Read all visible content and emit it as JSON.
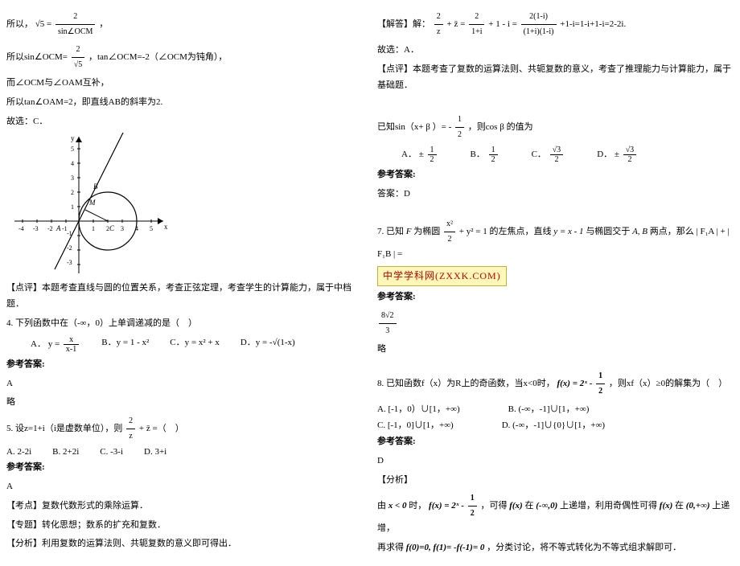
{
  "col1": {
    "line1_pre": "所以，",
    "line1_sqrt": "√5",
    "line1_eq": "=",
    "line1_frac_n": "2",
    "line1_frac_d": "sin∠OCM",
    "line1_post": "，",
    "line2_pre": "所以sin∠OCM=",
    "line2_frac_n": "2",
    "line2_frac_d": "√5",
    "line2_post": "，tan∠OCM=-2（∠OCM为钝角），",
    "line3": "而∠OCM与∠OAM互补，",
    "line4": "所以tan∠OAM=2，即直线AB的斜率为2.",
    "line5": "故选：C．",
    "comment1": "【点评】本题考查直线与圆的位置关系，考查正弦定理，考查学生的计算能力，属于中档题．",
    "q4_stem": "4. 下列函数中在（-∞，0）上单调递减的是（　）",
    "q4_opts": {
      "a_pre": "A．",
      "a_body": "y =",
      "b_pre": "B．",
      "b_body": "y = 1 - x²",
      "c_pre": "C．",
      "c_body": "y = x² + x",
      "d_pre": "D．",
      "d_body": "y = -√(1-x)"
    },
    "q4_fracA_n": "x",
    "q4_fracA_d": "x-1",
    "ref_label": "参考答案:",
    "q4_ans": "A",
    "q4_ext": "略",
    "q5_stem_pre": "5. 设z=1+i（i是虚数单位），则",
    "q5_frac_n": "2",
    "q5_frac_d": "z",
    "q5_plus": "+ z̄",
    "q5_stem_post": "=（　）",
    "q5_opts": {
      "a": "A. 2-2i",
      "b": "B. 2+2i",
      "c": "C. -3-i",
      "d": "D. 3+i"
    },
    "q5_ans": "A",
    "kd": "【考点】复数代数形式的乘除运算．",
    "zt": "【专题】转化思想；数系的扩充和复数．",
    "fx": "【分析】利用复数的运算法则、共轭复数的意义即可得出．"
  },
  "col2": {
    "jda_pre": "【解答】解：",
    "jda_frac1_n": "2",
    "jda_frac1_d": "z",
    "jda_plus": "+ z̄",
    "jda_eq1": " = ",
    "jda_frac2_n": "2",
    "jda_frac2_d": "1+i",
    "jda_plus2": " + 1 - i ",
    "jda_eq2": "= ",
    "jda_frac3_n": "2(1-i)",
    "jda_frac3_d": "(1+i)(1-i)",
    "jda_tail": " +1-i=1-i+1-i=2-2i.",
    "gx": "故选：A．",
    "dp": "【点评】本题考查了复数的运算法则、共轭复数的意义，考查了推理能力与计算能力，属于基础题．",
    "q6_stem_pre": "已知sin（x+",
    "q6_beta": "β",
    "q6_stem_mid": "）= ",
    "q6_frac_n": "1",
    "q6_frac_d": "2",
    "q6_neg": "-",
    "q6_stem_post": "，则cos",
    "q6_beta2": "β",
    "q6_stem_end": "的值为",
    "q6_opts_pm": "±",
    "q6_opts_half_n": "1",
    "q6_opts_half_d": "2",
    "q6_opts_r3_n": "√3",
    "q6_opts_r3_d": "2",
    "q6_labels": {
      "a": "A．",
      "b": "B．",
      "c": "C．",
      "d": "D．"
    },
    "ref_label": "参考答案:",
    "ansD": "答案：D",
    "q7_pre": "7. 已知",
    "q7_F": "F",
    "q7_mid": "为椭圆",
    "q7_ell_n": "x²",
    "q7_ell_d": "2",
    "q7_ell_tail": " + y² = 1",
    "q7_mid2": "的左焦点，直线",
    "q7_line": "y = x - 1",
    "q7_mid3": "与椭圆交于",
    "q7_AB": "A, B",
    "q7_mid4": "两点，那么",
    "q7_fa": "| F₁A | + | F₁B |",
    "q7_eq": " = ",
    "banner": "中学学科网(ZXXK.COM)",
    "q7_ans_n": "8√2",
    "q7_ans_d": "3",
    "q7_ext": "略",
    "q8_pre": "8. 已知函数f（x）为R上的奇函数，当x<0时，",
    "q8_fx": "f(x) = 2ˣ -",
    "q8_half_n": "1",
    "q8_half_d": "2",
    "q8_post": "，则xf（x）≥0的解集为（　）",
    "q8_opts": {
      "a": "A. [-1，0）∪[1，+∞)",
      "b": "B. (-∞，-1]∪[1，+∞)",
      "c": "C. [-1，0]∪[1，+∞)",
      "d": "D. (-∞，-1]∪{0}∪[1，+∞)"
    },
    "q8_ans": "D",
    "fx_label": "【分析】",
    "fx_line1_pre": "由",
    "fx_x0": "x < 0",
    "fx_line1_mid": "时，",
    "fx_line1_post": "，可得",
    "fx_inc1": "f(x)",
    "fx_in1": "在",
    "fx_dom1": "(-∞,0)",
    "fx_inc2": "上递增，利用奇偶性可得",
    "fx_dom2": "(0,+∞)",
    "fx_inc3": "上递增，",
    "fx_line2_pre": "再求得",
    "fx_f0": "f(0)=0, f(1)=",
    "fx_neg": "-f(-1)=",
    "fx_zero": "0",
    "fx_line2_post": "，分类讨论，将不等式转化为不等式组求解即可．"
  }
}
